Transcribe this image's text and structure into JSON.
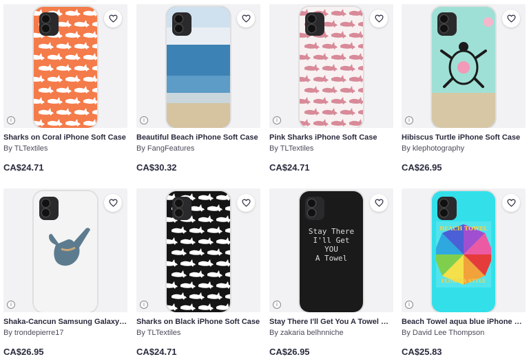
{
  "products": [
    {
      "title": "Sharks on Coral iPhone Soft Case",
      "artist": "By TLTextiles",
      "price": "CA$24.71",
      "art": "sharks",
      "bg": "#f47b4a",
      "pattern": "#ffffff"
    },
    {
      "title": "Beautiful Beach iPhone Soft Case",
      "artist": "By FangFeatures",
      "price": "CA$30.32",
      "art": "beach",
      "bg": "#4a89b8",
      "pattern": "#d9c9a5"
    },
    {
      "title": "Pink Sharks iPhone Soft Case",
      "artist": "By TLTextiles",
      "price": "CA$24.71",
      "art": "sharks",
      "bg": "#f7f1f2",
      "pattern": "#d88a98"
    },
    {
      "title": "Hibiscus Turtle iPhone Soft Case",
      "artist": "By klephotography",
      "price": "CA$26.95",
      "art": "turtle",
      "bg": "#8fd8cf",
      "pattern": "#1b1b1b"
    },
    {
      "title": "Shaka-Cancun Samsung Galaxy S...",
      "artist": "By trondepierre17",
      "price": "CA$26.95",
      "art": "shaka",
      "bg": "#f6f6f6",
      "pattern": "#5d7b8e"
    },
    {
      "title": "Sharks on Black iPhone Soft Case",
      "artist": "By TLTextiles",
      "price": "CA$24.71",
      "art": "sharks",
      "bg": "#151515",
      "pattern": "#ffffff"
    },
    {
      "title": "Stay There I'll Get You A Towel Shir...",
      "artist": "By zakaria belhnniche",
      "price": "CA$26.95",
      "art": "text",
      "bg": "#1a1a1a",
      "pattern": "#dddddd",
      "case_text": [
        "Stay There",
        "I'll Get",
        "YOU",
        "A Towel"
      ]
    },
    {
      "title": "Beach Towel aqua blue iPhone Sof...",
      "artist": "By David Lee Thompson",
      "price": "CA$25.83",
      "art": "towel",
      "bg": "#33e0ea",
      "pattern": "#f2a23a",
      "case_text": [
        "BEACH TOWEL",
        "FLORIDA STYLE"
      ]
    }
  ],
  "icons": {
    "favorite": "heart-outline-icon",
    "info": "info-icon"
  },
  "info_glyph": "i"
}
